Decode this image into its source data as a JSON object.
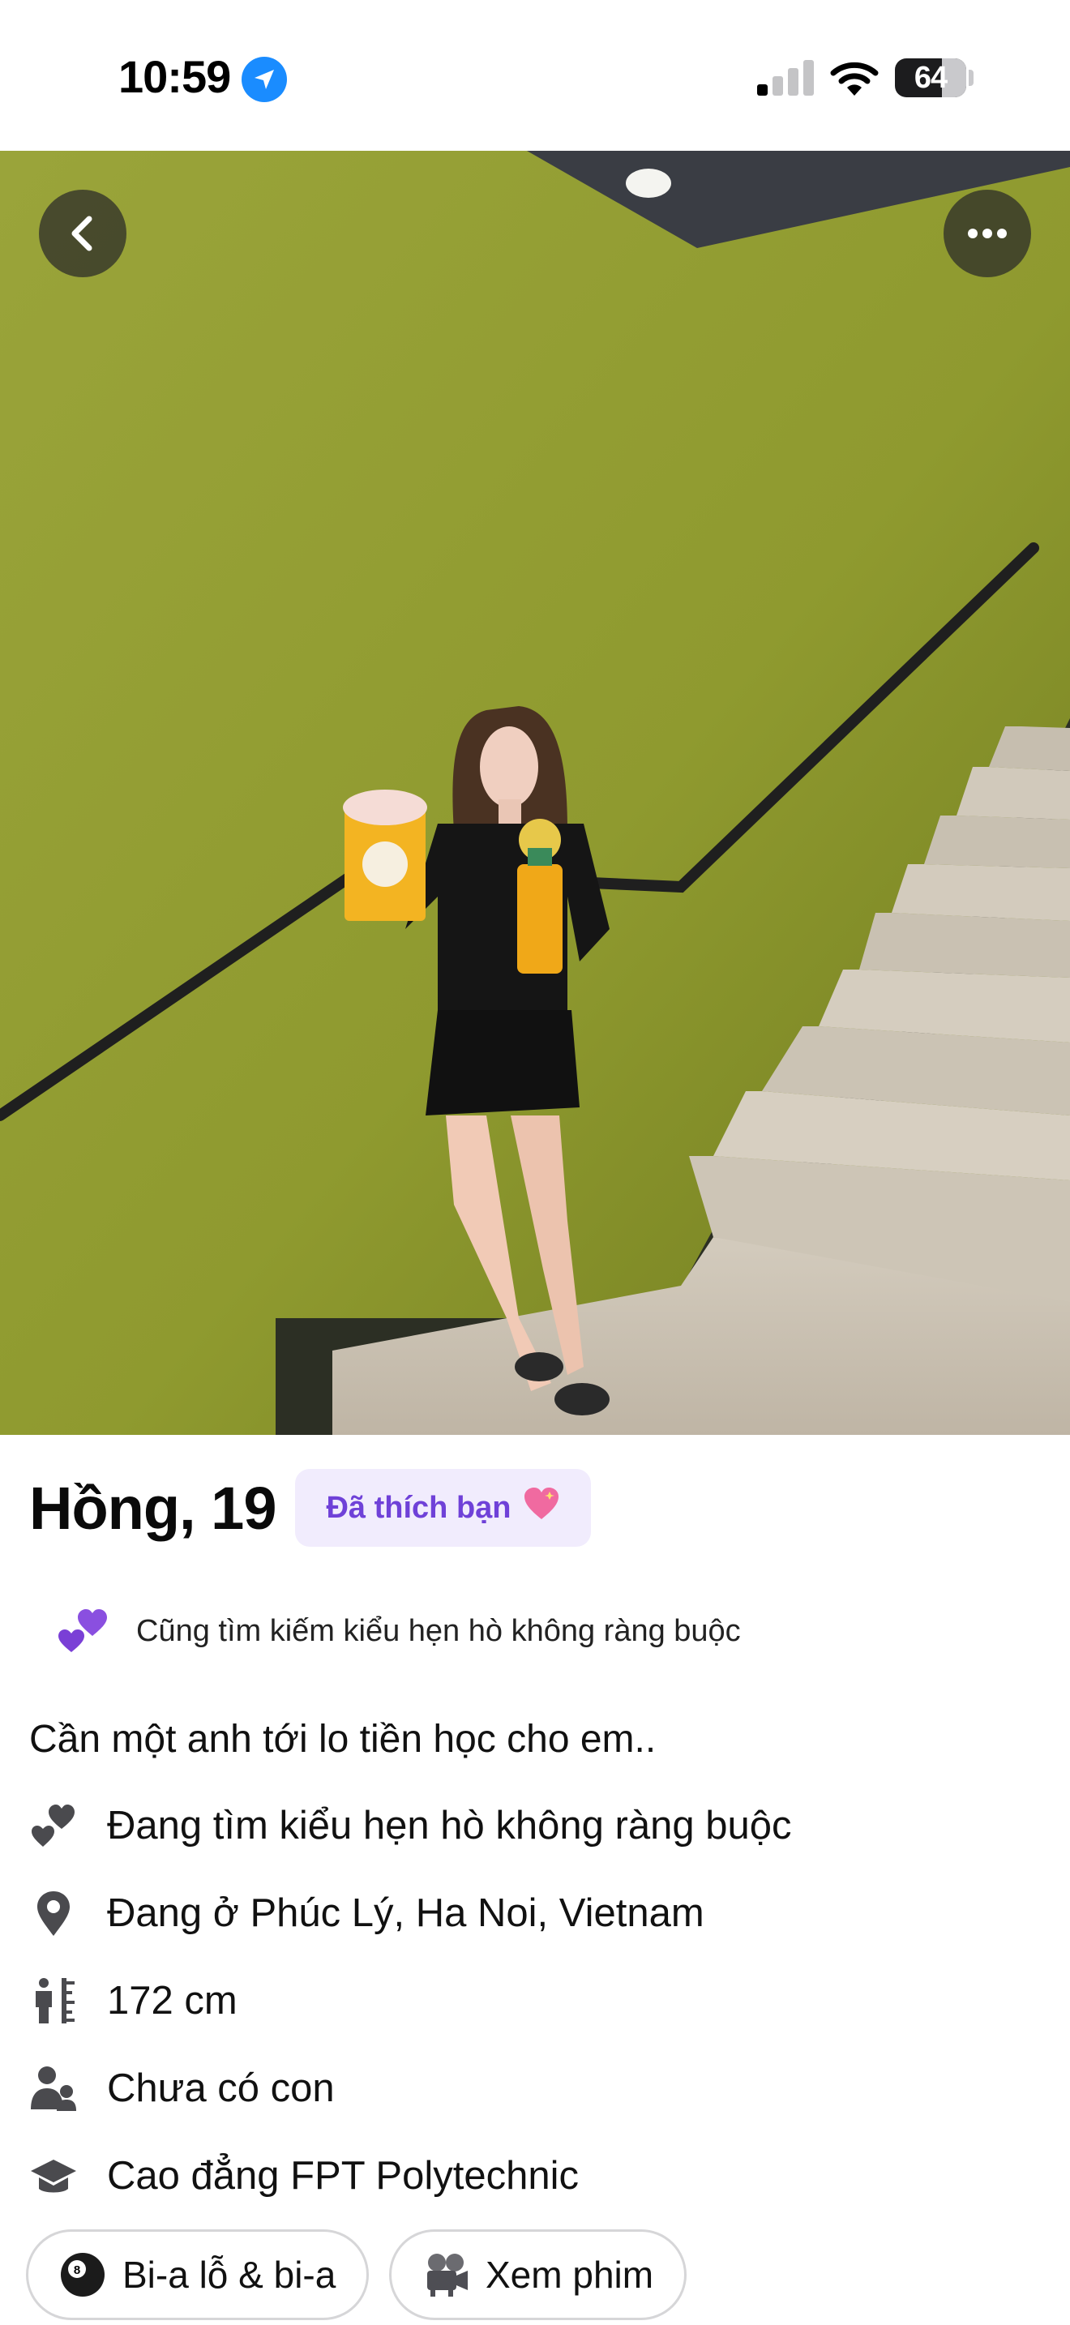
{
  "status_bar": {
    "time": "10:59",
    "battery": "64",
    "location_icon": "location-arrow-icon",
    "signal_icon": "cellular-signal-icon",
    "wifi_icon": "wifi-icon"
  },
  "photo": {
    "back_icon": "chevron-left-icon",
    "more_icon": "ellipsis-icon"
  },
  "profile": {
    "name_age": "Hồng, 19",
    "liked_badge": "Đã thích bạn",
    "also_seeking": "Cũng tìm kiếm kiểu hẹn hò không ràng buộc",
    "bio": "Cần một anh tới lo tiền học cho em..",
    "details": [
      {
        "icon": "hearts-icon",
        "text": "Đang tìm kiểu hẹn hò không ràng buộc"
      },
      {
        "icon": "location-pin-icon",
        "text": "Đang ở Phúc Lý, Ha Noi, Vietnam"
      },
      {
        "icon": "height-icon",
        "text": "172 cm"
      },
      {
        "icon": "people-icon",
        "text": "Chưa có con"
      },
      {
        "icon": "graduation-cap-icon",
        "text": "Cao đẳng FPT Polytechnic"
      }
    ],
    "interests": [
      {
        "icon": "billiard-ball-icon",
        "label": "Bi-a lỗ & bi-a"
      },
      {
        "icon": "movie-camera-icon",
        "label": "Xem phim"
      }
    ]
  },
  "colors": {
    "accent": "#6f41d8",
    "badge_bg": "#f1ecfd",
    "wall": "#8f9a2f",
    "location_blue": "#1a8cff"
  }
}
